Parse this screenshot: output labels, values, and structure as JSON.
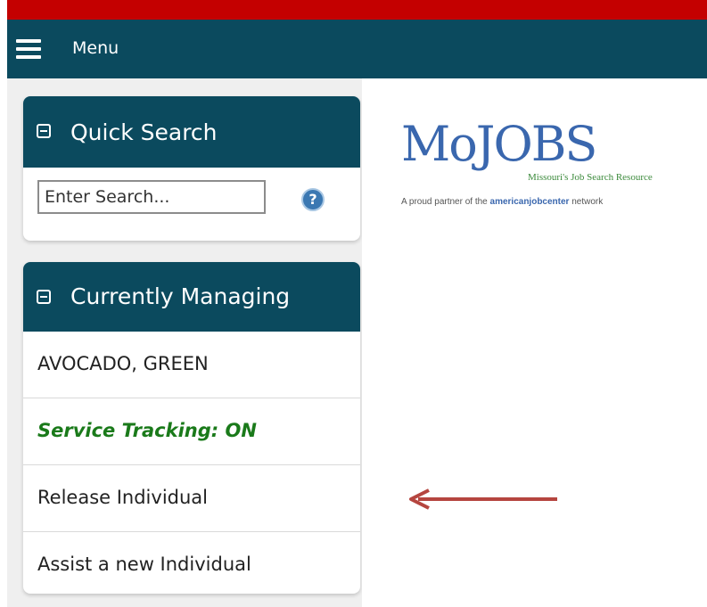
{
  "nav": {
    "menu_label": "Menu"
  },
  "quick_search": {
    "title": "Quick Search",
    "placeholder": "Enter Search..."
  },
  "managing": {
    "title": "Currently Managing",
    "items": [
      {
        "label": "AVOCADO, GREEN"
      },
      {
        "label": "Service Tracking: ON"
      },
      {
        "label": "Release Individual"
      },
      {
        "label": "Assist a new Individual"
      }
    ]
  },
  "logo": {
    "name": "MoJOBS",
    "subtitle": "Missouri's Job Search Resource",
    "tagline_prefix": "A proud partner of the ",
    "tagline_brand": "americanjobcenter",
    "tagline_suffix": " network"
  },
  "colors": {
    "navy": "#0b4a5e",
    "red_bar": "#c40000",
    "green_status": "#1a7a1a",
    "arrow": "#b5453f"
  }
}
